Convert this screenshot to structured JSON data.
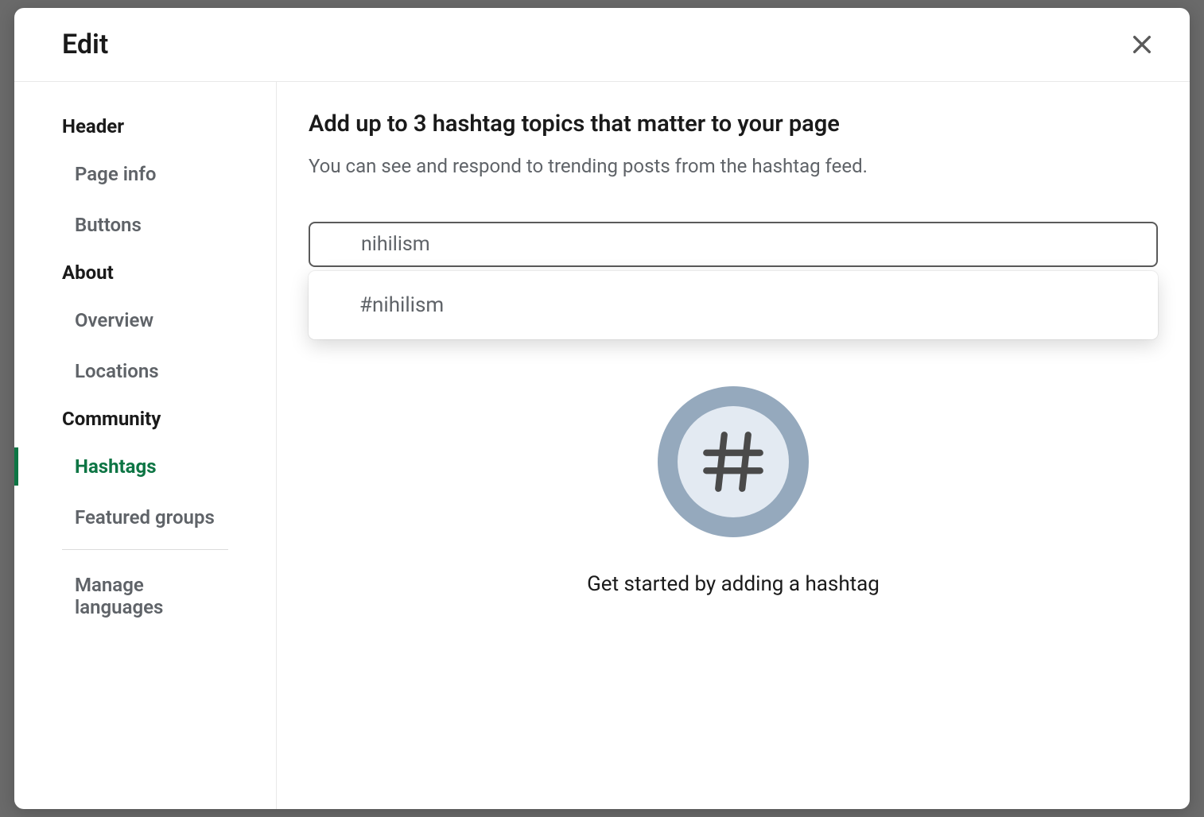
{
  "modal": {
    "title": "Edit"
  },
  "sidebar": {
    "sections": [
      {
        "title": "Header",
        "items": [
          {
            "label": "Page info",
            "active": false
          },
          {
            "label": "Buttons",
            "active": false
          }
        ]
      },
      {
        "title": "About",
        "items": [
          {
            "label": "Overview",
            "active": false
          },
          {
            "label": "Locations",
            "active": false
          }
        ]
      },
      {
        "title": "Community",
        "items": [
          {
            "label": "Hashtags",
            "active": true
          },
          {
            "label": "Featured groups",
            "active": false
          }
        ]
      }
    ],
    "footer_item": "Manage languages"
  },
  "main": {
    "heading": "Add up to 3 hashtag topics that matter to your page",
    "subtext": "You can see and respond to trending posts from the hashtag feed.",
    "input_value": "nihilism",
    "suggestions": [
      {
        "label": "#nihilism"
      }
    ],
    "empty_state_text": "Get started by adding a hashtag"
  }
}
